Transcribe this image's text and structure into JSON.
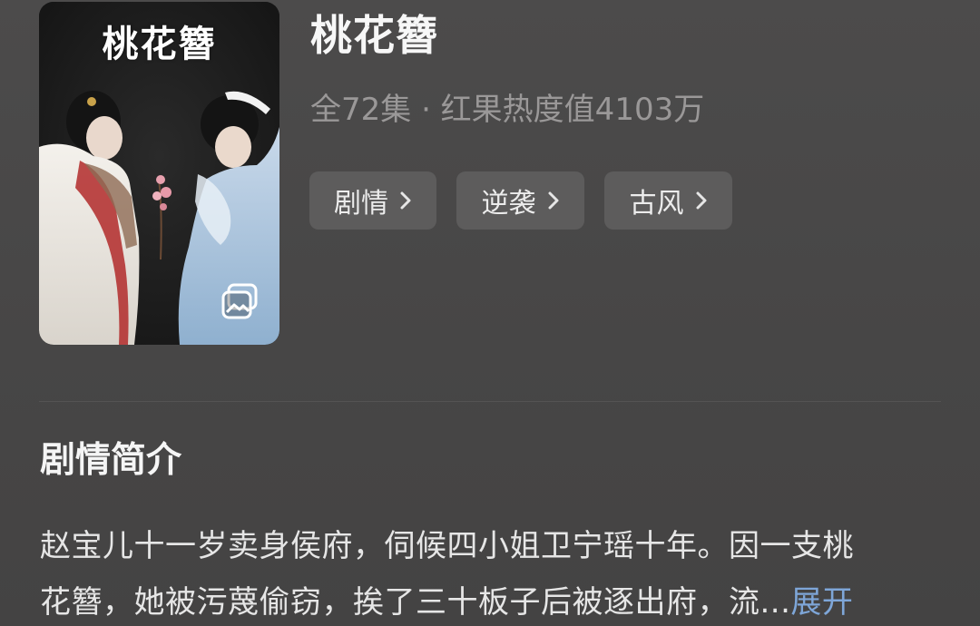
{
  "poster": {
    "title_text": "桃花簪",
    "gallery_icon": "gallery-icon"
  },
  "show": {
    "title": "桃花簪",
    "meta": "全72集 · 红果热度值4103万"
  },
  "tags": [
    {
      "label": "剧情",
      "icon": "chevron-right-icon"
    },
    {
      "label": "逆袭",
      "icon": "chevron-right-icon"
    },
    {
      "label": "古风",
      "icon": "chevron-right-icon"
    }
  ],
  "synopsis": {
    "heading": "剧情简介",
    "line1": "赵宝儿十一岁卖身侯府，伺候四小姐卫宁瑶十年。因一支桃",
    "line2": "花簪，她被污蔑偷窃，挨了三十板子后被逐出府，流...",
    "expand_label": "展开"
  },
  "colors": {
    "background": "#4a4949",
    "tag_background": "#5d5c5c",
    "meta_text": "#9a9898",
    "link": "#7ea6d8"
  }
}
